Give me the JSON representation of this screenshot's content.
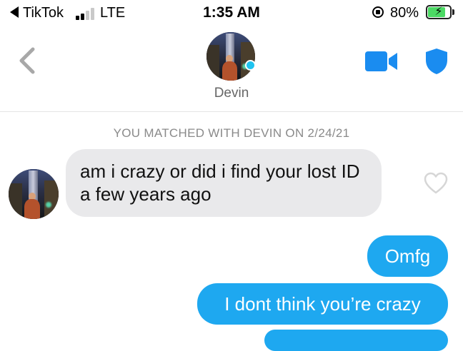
{
  "status_bar": {
    "back_app": "TikTok",
    "network": "LTE",
    "time": "1:35 AM",
    "battery_percent": "80%",
    "battery_level": 0.8,
    "signal_bars_active": 2,
    "signal_bars_total": 4,
    "icons": [
      "back-triangle-icon",
      "signal-bars-icon",
      "orientation-lock-icon",
      "battery-charging-icon"
    ]
  },
  "header": {
    "contact_name": "Devin",
    "online": true,
    "icons": [
      "chevron-left-icon",
      "avatar",
      "video-camera-icon",
      "shield-icon"
    ]
  },
  "chat": {
    "match_notice": "YOU MATCHED WITH DEVIN ON 2/24/21",
    "messages": [
      {
        "direction": "received",
        "text": "am i crazy or did i find your lost ID a few years ago",
        "liked": false
      },
      {
        "direction": "sent",
        "text": "Omfg"
      },
      {
        "direction": "sent",
        "text": "I dont think you’re crazy"
      }
    ]
  },
  "colors": {
    "sent_bubble": "#1ea8f0",
    "received_bubble": "#e9e9eb",
    "accent_blue": "#1a8cf0",
    "online_dot": "#1fc3f0",
    "battery_fill": "#4cd964"
  }
}
